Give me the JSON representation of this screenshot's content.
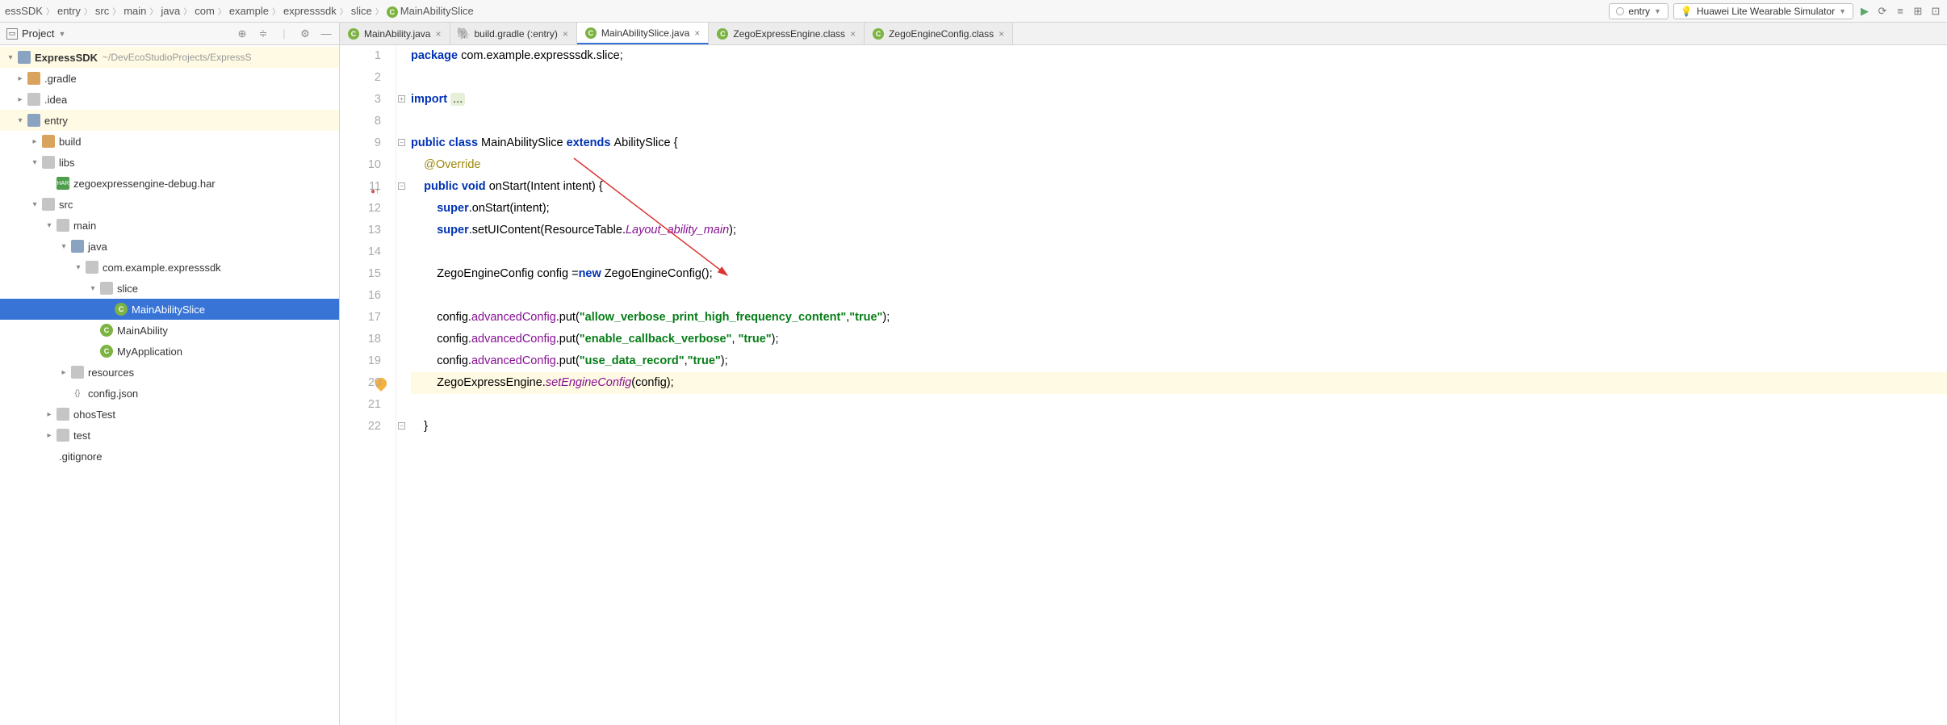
{
  "breadcrumb": [
    "essSDK",
    "entry",
    "src",
    "main",
    "java",
    "com",
    "example",
    "expresssdk",
    "slice",
    "MainAbilitySlice"
  ],
  "dropdowns": {
    "module": "entry",
    "target": "Huawei Lite Wearable Simulator"
  },
  "sidebar": {
    "title": "Project"
  },
  "project": {
    "root": "ExpressSDK",
    "rootPath": "~/DevEcoStudioProjects/ExpressS",
    "nodes": [
      {
        "d": 0,
        "chev": ">",
        "icon": "folder",
        "label": ".gradle"
      },
      {
        "d": 0,
        "chev": ">",
        "icon": "folder-g",
        "label": ".idea"
      },
      {
        "d": 0,
        "chev": "v",
        "icon": "folder-s",
        "label": "entry",
        "hl": true
      },
      {
        "d": 1,
        "chev": ">",
        "icon": "folder",
        "label": "build"
      },
      {
        "d": 1,
        "chev": "v",
        "icon": "folder-g",
        "label": "libs"
      },
      {
        "d": 2,
        "chev": "",
        "icon": "har",
        "label": "zegoexpressengine-debug.har"
      },
      {
        "d": 1,
        "chev": "v",
        "icon": "folder-g",
        "label": "src"
      },
      {
        "d": 2,
        "chev": "v",
        "icon": "folder-g",
        "label": "main"
      },
      {
        "d": 3,
        "chev": "v",
        "icon": "folder-s",
        "label": "java"
      },
      {
        "d": 4,
        "chev": "v",
        "icon": "folder-g",
        "label": "com.example.expresssdk"
      },
      {
        "d": 5,
        "chev": "v",
        "icon": "folder-g",
        "label": "slice"
      },
      {
        "d": 6,
        "chev": "",
        "icon": "class",
        "label": "MainAbilitySlice",
        "sel": true
      },
      {
        "d": 5,
        "chev": "",
        "icon": "class",
        "label": "MainAbility"
      },
      {
        "d": 5,
        "chev": "",
        "icon": "class",
        "label": "MyApplication"
      },
      {
        "d": 3,
        "chev": ">",
        "icon": "folder-g",
        "label": "resources"
      },
      {
        "d": 3,
        "chev": "",
        "icon": "json",
        "label": "config.json"
      },
      {
        "d": 2,
        "chev": ">",
        "icon": "folder-g",
        "label": "ohosTest"
      },
      {
        "d": 2,
        "chev": ">",
        "icon": "folder-g",
        "label": "test"
      },
      {
        "d": 1,
        "chev": "",
        "icon": "file",
        "label": ".gitignore"
      }
    ]
  },
  "tabs": [
    {
      "label": "MainAbility.java",
      "icon": "class"
    },
    {
      "label": "build.gradle (:entry)",
      "icon": "gradle"
    },
    {
      "label": "MainAbilitySlice.java",
      "icon": "class",
      "active": true
    },
    {
      "label": "ZegoExpressEngine.class",
      "icon": "class"
    },
    {
      "label": "ZegoEngineConfig.class",
      "icon": "class"
    }
  ],
  "gutter": [
    "1",
    "2",
    "3",
    "8",
    "9",
    "10",
    "11",
    "12",
    "13",
    "14",
    "15",
    "16",
    "17",
    "18",
    "19",
    "20",
    "21",
    "22"
  ],
  "code": [
    {
      "t": [
        [
          "kw",
          "package "
        ],
        [
          "nm",
          "com.example.expresssdk.slice;"
        ]
      ]
    },
    {
      "t": []
    },
    {
      "t": [
        [
          "kw",
          "import "
        ],
        [
          "folded",
          "..."
        ]
      ],
      "fold": "+"
    },
    {
      "t": []
    },
    {
      "t": [
        [
          "kw",
          "public class "
        ],
        [
          "nm",
          "MainAbilitySlice "
        ],
        [
          "kw",
          "extends "
        ],
        [
          "nm",
          "AbilitySlice {"
        ]
      ],
      "fold": "-"
    },
    {
      "t": [
        [
          "nm",
          "    "
        ],
        [
          "ann",
          "@Override"
        ]
      ]
    },
    {
      "t": [
        [
          "nm",
          "    "
        ],
        [
          "kw",
          "public void "
        ],
        [
          "nm",
          "onStart(Intent intent) {"
        ]
      ],
      "fold": "-",
      "mark": "override"
    },
    {
      "t": [
        [
          "nm",
          "        "
        ],
        [
          "kw",
          "super"
        ],
        [
          "nm",
          ".onStart(intent);"
        ]
      ]
    },
    {
      "t": [
        [
          "nm",
          "        "
        ],
        [
          "kw",
          "super"
        ],
        [
          "nm",
          ".setUIContent(ResourceTable."
        ],
        [
          "itfield",
          "Layout_ability_main"
        ],
        [
          "nm",
          ");"
        ]
      ]
    },
    {
      "t": []
    },
    {
      "t": [
        [
          "nm",
          "        ZegoEngineConfig config ="
        ],
        [
          "kw",
          "new "
        ],
        [
          "nm",
          "ZegoEngineConfig();"
        ]
      ]
    },
    {
      "t": []
    },
    {
      "t": [
        [
          "nm",
          "        config."
        ],
        [
          "field",
          "advancedConfig"
        ],
        [
          "nm",
          ".put("
        ],
        [
          "str",
          "\"allow_verbose_print_high_frequency_content\""
        ],
        [
          "nm",
          ","
        ],
        [
          "str",
          "\"true\""
        ],
        [
          "nm",
          ");"
        ]
      ]
    },
    {
      "t": [
        [
          "nm",
          "        config."
        ],
        [
          "field",
          "advancedConfig"
        ],
        [
          "nm",
          ".put("
        ],
        [
          "str",
          "\"enable_callback_verbose\""
        ],
        [
          "nm",
          ", "
        ],
        [
          "str",
          "\"true\""
        ],
        [
          "nm",
          ");"
        ]
      ]
    },
    {
      "t": [
        [
          "nm",
          "        config."
        ],
        [
          "field",
          "advancedConfig"
        ],
        [
          "nm",
          ".put("
        ],
        [
          "str",
          "\"use_data_record\""
        ],
        [
          "nm",
          ","
        ],
        [
          "str",
          "\"true\""
        ],
        [
          "nm",
          ");"
        ]
      ]
    },
    {
      "t": [
        [
          "nm",
          "        ZegoExpressEngine."
        ],
        [
          "itfield",
          "setEngineConfig"
        ],
        [
          "nm",
          "(config);"
        ]
      ],
      "hl": true,
      "bulb": true
    },
    {
      "t": []
    },
    {
      "t": [
        [
          "nm",
          "    }"
        ]
      ],
      "fold": "-"
    }
  ]
}
